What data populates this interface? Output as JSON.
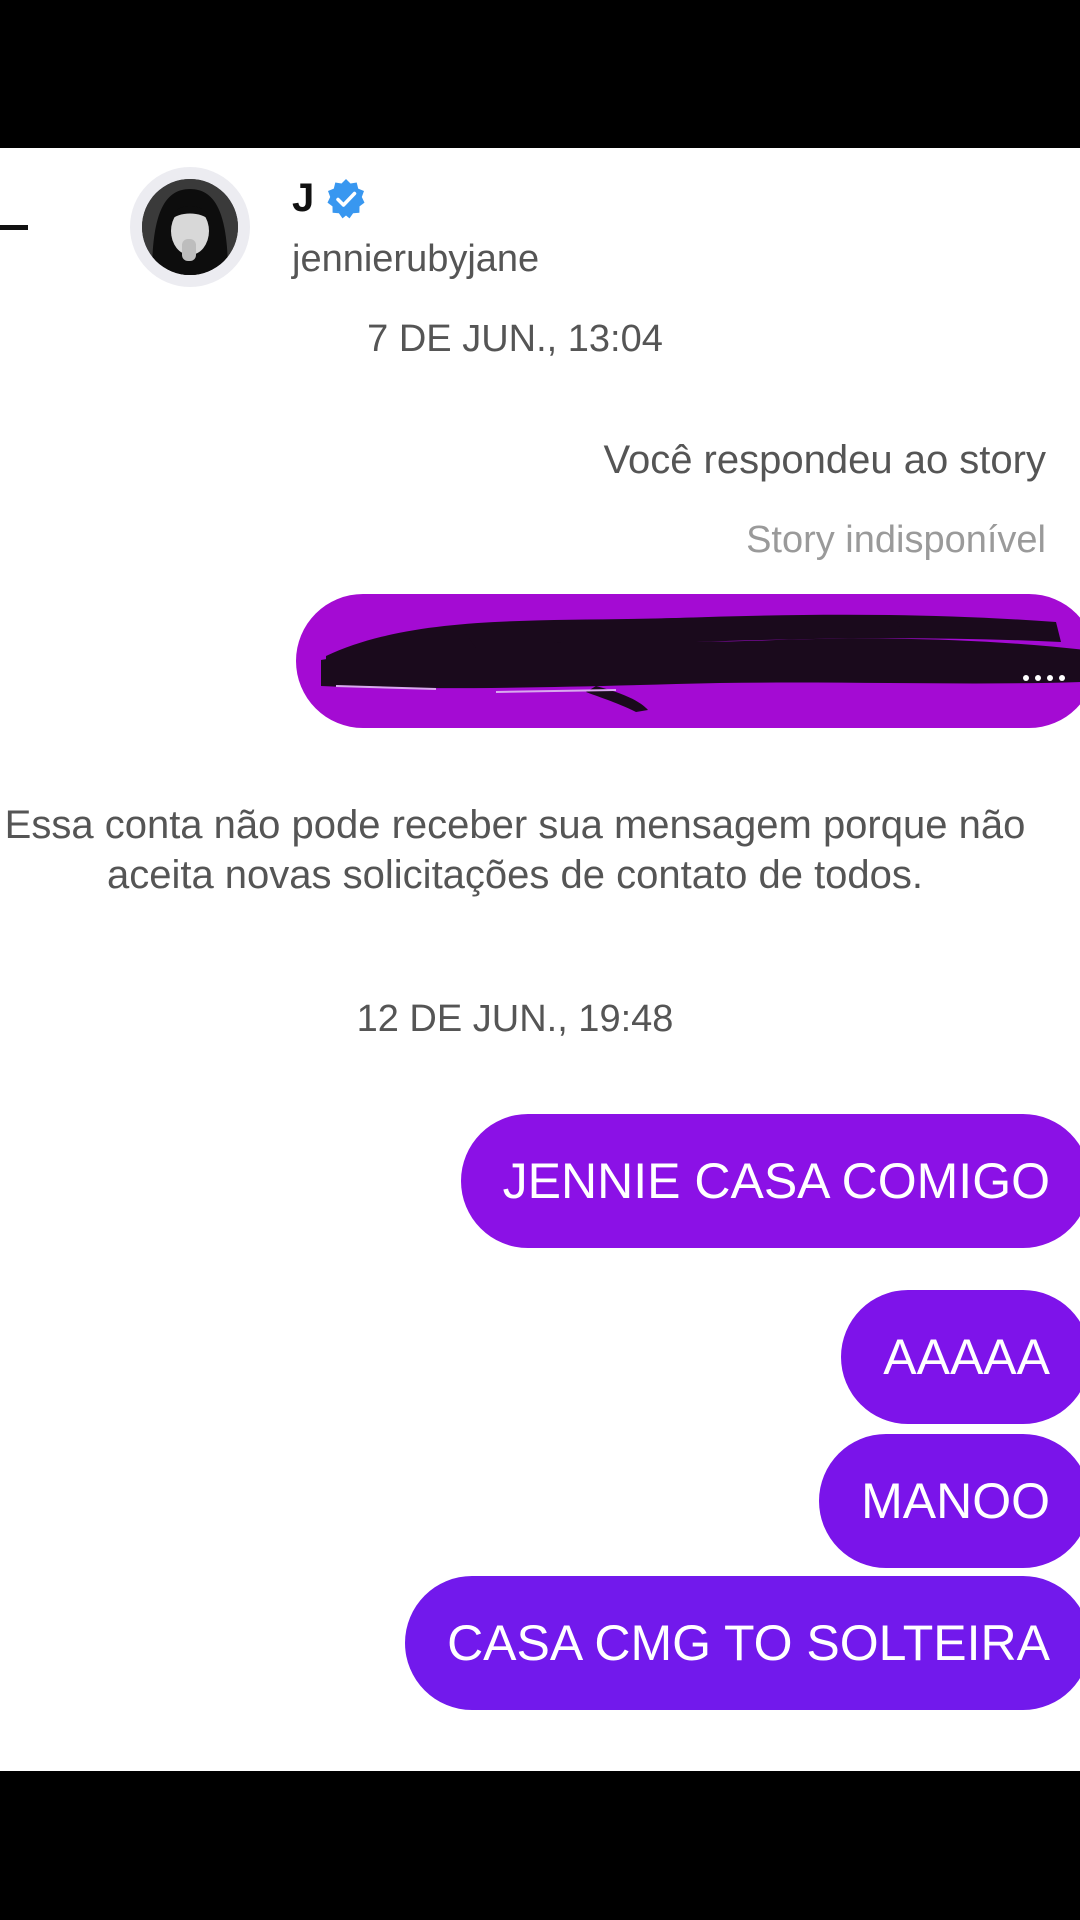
{
  "header": {
    "display_name": "J",
    "username": "jennierubyjane",
    "verified": true,
    "verified_color": "#3897f0",
    "avatar_icon": "profile-photo"
  },
  "thread": {
    "first_timestamp": "7 DE JUN., 13:04",
    "reply_note": "Você respondeu ao story",
    "story_status": "Story indisponível",
    "redacted_message_color": "#a40bd3",
    "system_message": "Essa conta não pode receber sua mensagem porque não aceita novas solicitações de contato de todos.",
    "second_timestamp": "12 DE JUN., 19:48",
    "messages": [
      {
        "text": "JENNIE CASA COMIGO",
        "color": "#8b11e6"
      },
      {
        "text": "AAAAA",
        "color": "#7e13ea"
      },
      {
        "text": "MANOO",
        "color": "#7a14ea"
      },
      {
        "text": "CASA CMG TO SOLTEIRA",
        "color": "#7219ec"
      }
    ]
  }
}
